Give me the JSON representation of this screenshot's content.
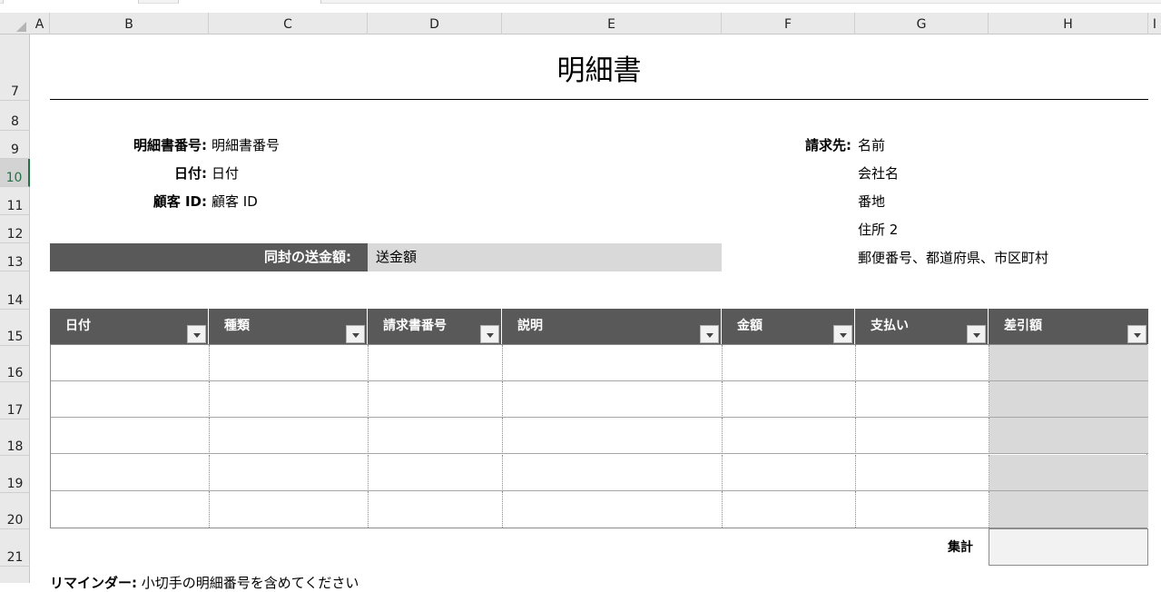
{
  "sheet": {
    "columns": [
      "A",
      "B",
      "C",
      "D",
      "E",
      "F",
      "G",
      "H",
      "I"
    ],
    "rows": [
      "7",
      "8",
      "9",
      "10",
      "11",
      "12",
      "13",
      "14",
      "15",
      "16",
      "17",
      "18",
      "19",
      "20",
      "21"
    ],
    "selected_row": "10"
  },
  "title": "明細書",
  "left_fields": [
    {
      "label": "明細書番号:",
      "value": "明細書番号"
    },
    {
      "label": "日付:",
      "value": "日付"
    },
    {
      "label": "顧客 ID:",
      "value": "顧客 ID"
    }
  ],
  "bill_to": {
    "label": "請求先:",
    "lines": [
      "名前",
      "会社名",
      "番地",
      "住所 2",
      "郵便番号、都道府県、市区町村"
    ]
  },
  "enclosed": {
    "label": "同封の送金額:",
    "value": "送金額"
  },
  "table": {
    "headers": [
      "日付",
      "種類",
      "請求書番号",
      "説明",
      "金額",
      "支払い",
      "差引額"
    ],
    "row_count": 5
  },
  "total_label": "集計",
  "reminder": {
    "bold": "リマインダー:",
    "text": " 小切手の明細番号を含めてください"
  },
  "colors": {
    "header_bg": "#595959",
    "light_fill": "#d9d9d9",
    "selected_row": "#217346"
  }
}
